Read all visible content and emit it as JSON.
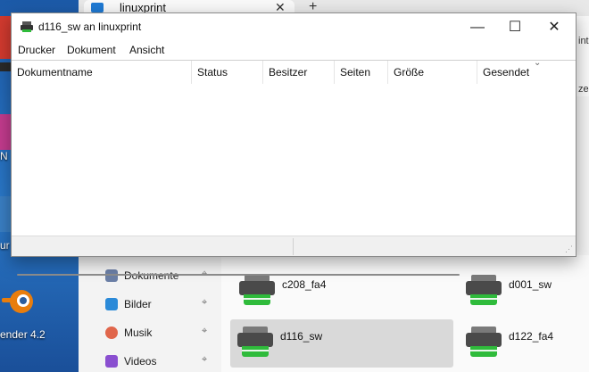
{
  "desktop": {
    "labels": [
      "N",
      "ur",
      "ender 4.2"
    ]
  },
  "explorer": {
    "tab_title": "linuxprint",
    "tab_close": "✕",
    "new_tab": "+",
    "edge_labels": [
      "int",
      "zei"
    ],
    "sidebar": [
      {
        "label": "Dokumente",
        "icon": "documents-icon",
        "color": "#6b7fa6"
      },
      {
        "label": "Bilder",
        "icon": "pictures-icon",
        "color": "#2b8ad8"
      },
      {
        "label": "Musik",
        "icon": "music-icon",
        "color": "#e0664b"
      },
      {
        "label": "Videos",
        "icon": "videos-icon",
        "color": "#8a4fd0"
      }
    ],
    "pin_glyph": "📌",
    "printers": [
      {
        "name": "c208_fa4"
      },
      {
        "name": "d001_sw"
      },
      {
        "name": "d116_sw"
      },
      {
        "name": "d122_fa4"
      }
    ]
  },
  "queue_window": {
    "title": "d116_sw an linuxprint",
    "buttons": {
      "minimize": "—",
      "maximize": "☐",
      "close": "✕"
    },
    "menu": [
      "Drucker",
      "Dokument",
      "Ansicht"
    ],
    "columns": [
      "Dokumentname",
      "Status",
      "Besitzer",
      "Seiten",
      "Größe",
      "Gesendet"
    ],
    "sort_caret": "⌄",
    "grip": "⋰"
  },
  "colors": {
    "accent": "#1f7ad4",
    "printer_tray": "#2fbb3b"
  }
}
